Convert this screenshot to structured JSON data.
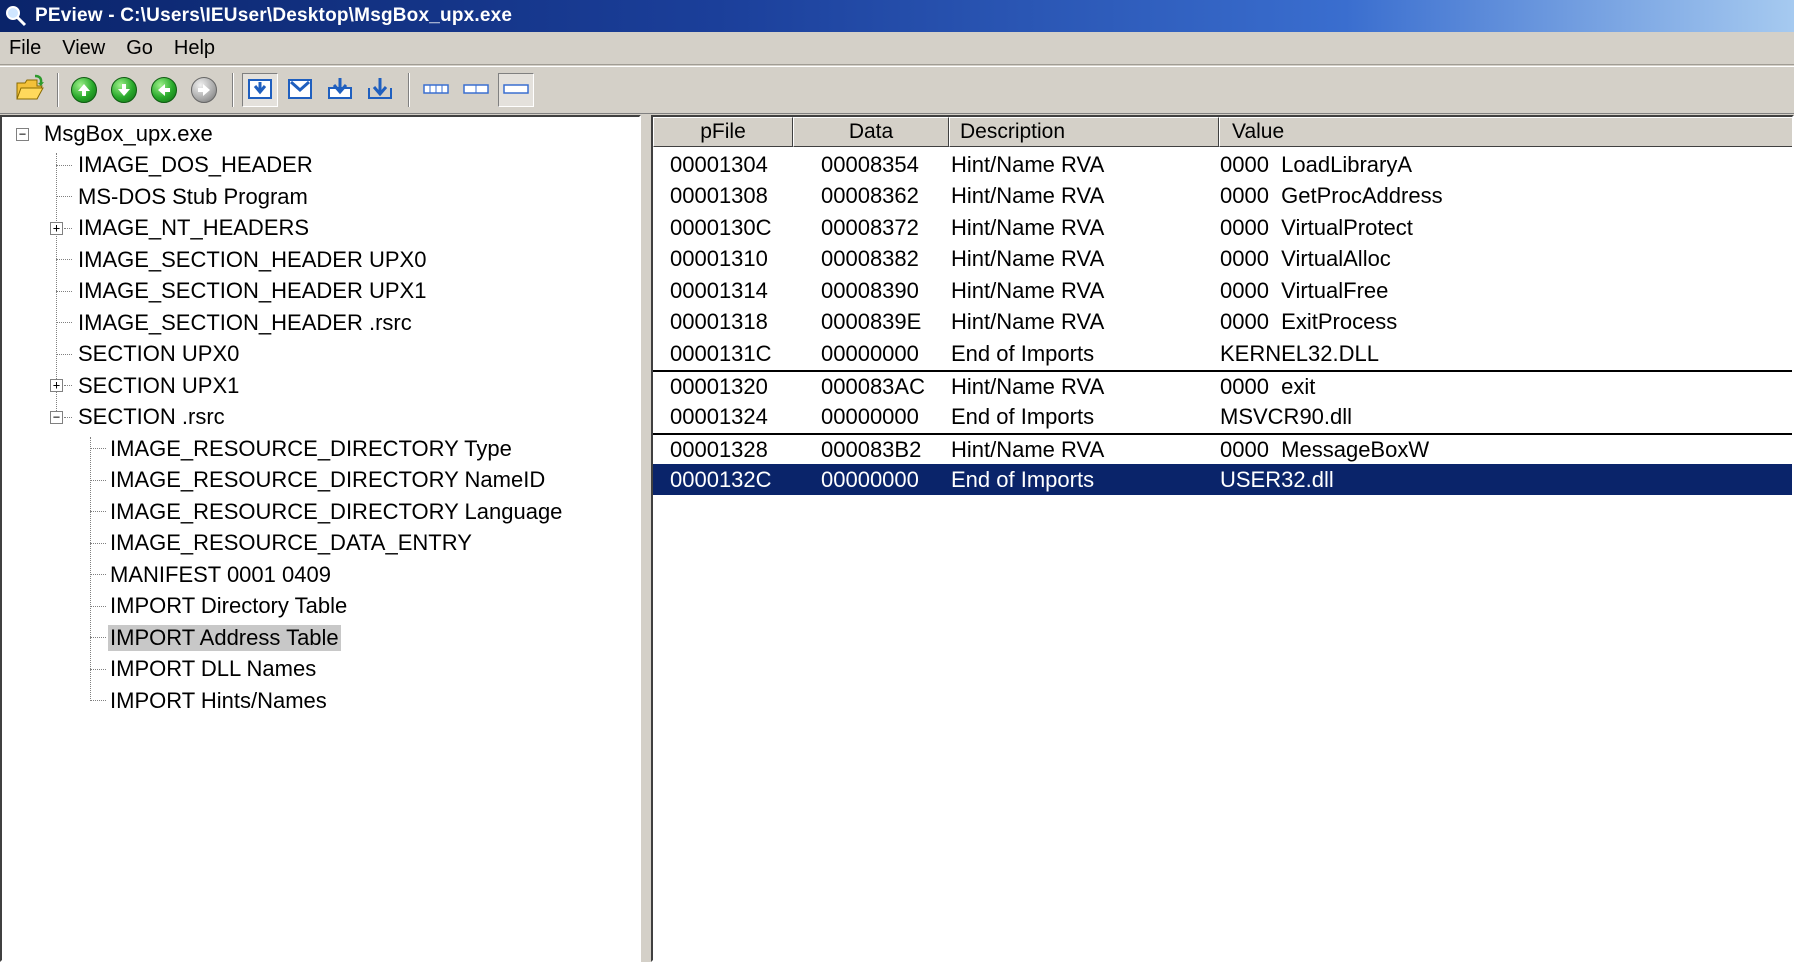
{
  "window": {
    "title": "PEview - C:\\Users\\IEUser\\Desktop\\MsgBox_upx.exe"
  },
  "menu": [
    "File",
    "View",
    "Go",
    "Help"
  ],
  "toolbar": {
    "icons": [
      "open-folder-icon",
      "arrow-up-icon",
      "arrow-down-icon",
      "arrow-left-icon",
      "arrow-right-icon",
      "view-mode-1-icon",
      "view-mode-2-icon",
      "view-mode-3-icon",
      "view-mode-4-icon",
      "byte-view-icon",
      "word-view-icon",
      "dword-view-icon"
    ]
  },
  "tree": {
    "root": "MsgBox_upx.exe",
    "level1": [
      "IMAGE_DOS_HEADER",
      "MS-DOS Stub Program",
      "IMAGE_NT_HEADERS",
      "IMAGE_SECTION_HEADER UPX0",
      "IMAGE_SECTION_HEADER UPX1",
      "IMAGE_SECTION_HEADER .rsrc",
      "SECTION UPX0",
      "SECTION UPX1",
      "SECTION .rsrc"
    ],
    "rsrc_children": [
      "IMAGE_RESOURCE_DIRECTORY Type",
      "IMAGE_RESOURCE_DIRECTORY NameID",
      "IMAGE_RESOURCE_DIRECTORY Language",
      "IMAGE_RESOURCE_DATA_ENTRY",
      "MANIFEST  0001  0409",
      "IMPORT Directory Table",
      "IMPORT Address Table",
      "IMPORT DLL Names",
      "IMPORT Hints/Names"
    ],
    "selected": "IMPORT Address Table"
  },
  "list": {
    "columns": [
      "pFile",
      "Data",
      "Description",
      "Value"
    ],
    "rows": [
      {
        "pfile": "00001304",
        "data": "00008354",
        "desc": "Hint/Name RVA",
        "value": "0000  LoadLibraryA"
      },
      {
        "pfile": "00001308",
        "data": "00008362",
        "desc": "Hint/Name RVA",
        "value": "0000  GetProcAddress"
      },
      {
        "pfile": "0000130C",
        "data": "00008372",
        "desc": "Hint/Name RVA",
        "value": "0000  VirtualProtect"
      },
      {
        "pfile": "00001310",
        "data": "00008382",
        "desc": "Hint/Name RVA",
        "value": "0000  VirtualAlloc"
      },
      {
        "pfile": "00001314",
        "data": "00008390",
        "desc": "Hint/Name RVA",
        "value": "0000  VirtualFree"
      },
      {
        "pfile": "00001318",
        "data": "0000839E",
        "desc": "Hint/Name RVA",
        "value": "0000  ExitProcess"
      },
      {
        "pfile": "0000131C",
        "data": "00000000",
        "desc": "End of Imports",
        "value": "KERNEL32.DLL"
      },
      {
        "pfile": "00001320",
        "data": "000083AC",
        "desc": "Hint/Name RVA",
        "value": "0000  exit"
      },
      {
        "pfile": "00001324",
        "data": "00000000",
        "desc": "End of Imports",
        "value": "MSVCR90.dll"
      },
      {
        "pfile": "00001328",
        "data": "000083B2",
        "desc": "Hint/Name RVA",
        "value": "0000  MessageBoxW"
      },
      {
        "pfile": "0000132C",
        "data": "00000000",
        "desc": "End of Imports",
        "value": "USER32.dll"
      }
    ],
    "selected_row": 10
  },
  "colors": {
    "selection": "#0a246a",
    "tree_selection": "#c8c8c8",
    "chrome": "#d4d0c8"
  }
}
